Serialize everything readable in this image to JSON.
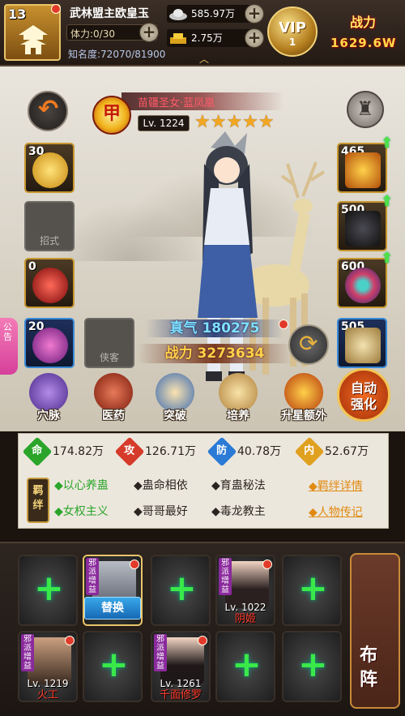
{
  "player": {
    "level": "13",
    "name": "武林盟主欧皇玉",
    "stamina_label": "体力:",
    "stamina_value": "0/30",
    "fame_label": "知名度:",
    "fame_value": "72070/81900"
  },
  "resources": {
    "silver": "585.97万",
    "gold": "2.75万"
  },
  "vip": {
    "label": "VIP",
    "level": "1"
  },
  "power": {
    "label": "战力",
    "value": "1629.6W"
  },
  "hero": {
    "rank_char": "甲",
    "name": "苗疆圣女·蓝凤凰",
    "level": "Lv. 1224",
    "stars": "★★★★★",
    "qi_label": "真气",
    "qi_value": "180275",
    "power_label": "战力",
    "power_value": "3273634"
  },
  "left_slots": [
    {
      "count": "30",
      "label": ""
    },
    {
      "count": "",
      "label": "招式"
    },
    {
      "count": "0",
      "label": ""
    },
    {
      "count": "20",
      "label": ""
    }
  ],
  "left_tab": "公告",
  "mid_slot_label": "侠客",
  "right_slots": [
    {
      "count": "465"
    },
    {
      "count": "500"
    },
    {
      "count": "600"
    },
    {
      "count": "505"
    }
  ],
  "functions": [
    {
      "label": "穴脉",
      "icon": "meridian-icon"
    },
    {
      "label": "医药",
      "icon": "medicine-icon"
    },
    {
      "label": "突破",
      "icon": "breakthrough-icon"
    },
    {
      "label": "培养",
      "icon": "train-icon"
    },
    {
      "label": "升星额外",
      "icon": "star-up-icon"
    }
  ],
  "auto_strengthen": "自动强化",
  "stats": [
    {
      "badge": "命",
      "value": "174.82万",
      "color": "#2aa52a"
    },
    {
      "badge": "攻",
      "value": "126.71万",
      "color": "#d63a2a"
    },
    {
      "badge": "防",
      "value": "40.78万",
      "color": "#2a7ad6"
    },
    {
      "badge": "内",
      "value": "52.67万",
      "color": "#e0a020"
    }
  ],
  "bond_seal": "羁绊",
  "bonds_row1": [
    {
      "text": "◆以心养蛊",
      "active": true
    },
    {
      "text": "◆蛊命相依",
      "active": false
    },
    {
      "text": "◆育蛊秘法",
      "active": false
    }
  ],
  "bonds_row2": [
    {
      "text": "◆女权主义",
      "active": true
    },
    {
      "text": "◆哥哥最好",
      "active": false
    },
    {
      "text": "◆毒龙教主",
      "active": false
    }
  ],
  "links": {
    "bond_detail": "◆羁绊详情",
    "bio": "◆人物传记"
  },
  "lineup": {
    "replace_label": "替换",
    "tag_text": "邪派增益",
    "heroes": [
      {
        "level": "Lv. 1022",
        "name": "阴姬"
      },
      {
        "level": "Lv. 1219",
        "name": "火工"
      },
      {
        "level": "Lv. 1261",
        "name": "千面修罗"
      }
    ],
    "formation_label": "布阵",
    "empty_plus": "+"
  },
  "colors": {
    "accent_gold": "#e9c46a",
    "bond_active": "#2aa52a",
    "link_orange": "#e08a12",
    "plus_green": "#3ae84a"
  }
}
